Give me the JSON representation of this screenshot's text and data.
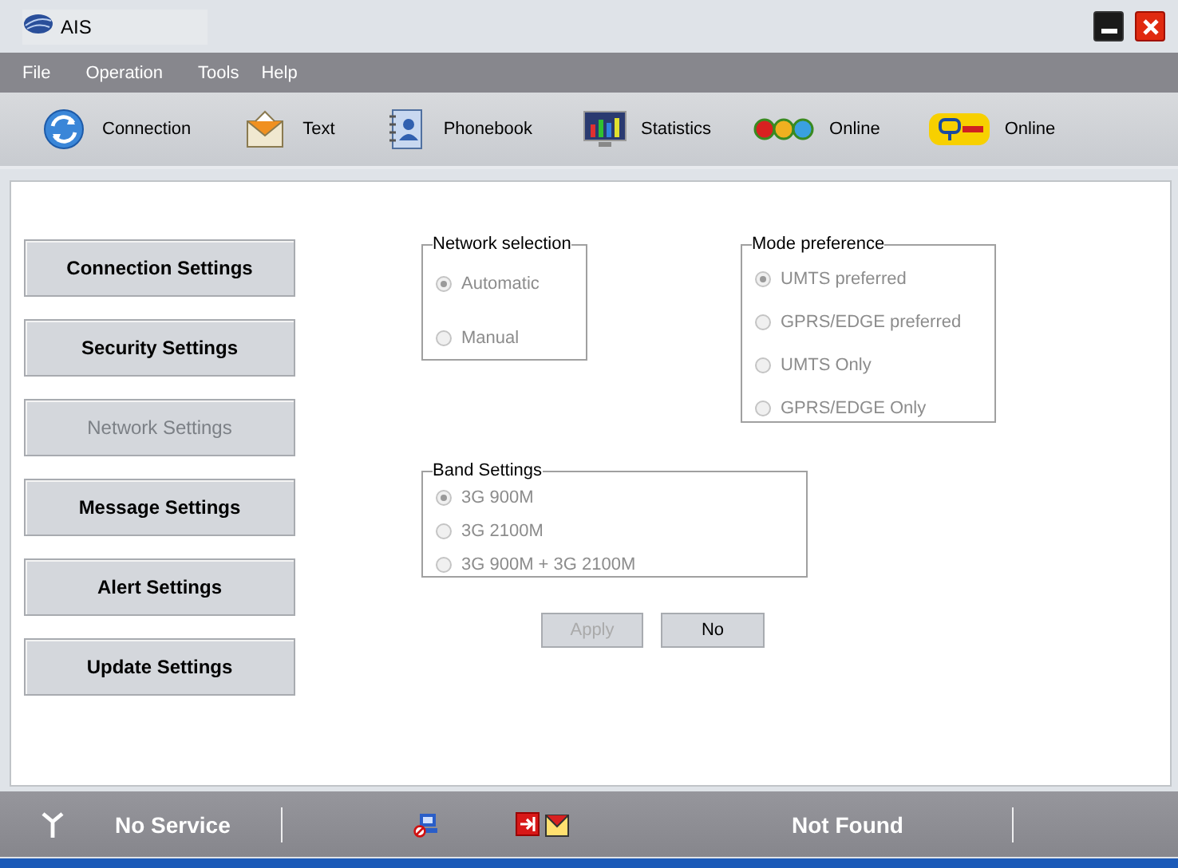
{
  "window": {
    "title": "AIS"
  },
  "menu": [
    "File",
    "Operation",
    "Tools",
    "Help"
  ],
  "toolbar": [
    {
      "kind": "connection",
      "label": "Connection"
    },
    {
      "kind": "text",
      "label": "Text"
    },
    {
      "kind": "phonebook",
      "label": "Phonebook"
    },
    {
      "kind": "statistics",
      "label": "Statistics"
    },
    {
      "kind": "call",
      "label": "Online"
    },
    {
      "kind": "gsm",
      "label": "Online"
    }
  ],
  "settings_buttons": [
    {
      "label": "Connection Settings",
      "disabled": false
    },
    {
      "label": "Security Settings",
      "disabled": false
    },
    {
      "label": "Network Settings",
      "disabled": true
    },
    {
      "label": "Message Settings",
      "disabled": false
    },
    {
      "label": "Alert Settings",
      "disabled": false
    },
    {
      "label": "Update Settings",
      "disabled": false
    }
  ],
  "network_selection": {
    "title": "Network selection",
    "options": [
      {
        "label": "Automatic",
        "selected": true,
        "disabled": true
      },
      {
        "label": "Manual",
        "selected": false,
        "disabled": true
      }
    ]
  },
  "mode_preference": {
    "title": "Mode preference",
    "options": [
      {
        "label": "UMTS preferred",
        "selected": true,
        "disabled": true
      },
      {
        "label": "GPRS/EDGE preferred",
        "selected": false,
        "disabled": true
      },
      {
        "label": "UMTS Only",
        "selected": false,
        "disabled": true
      },
      {
        "label": "GPRS/EDGE Only",
        "selected": false,
        "disabled": true
      }
    ]
  },
  "band_settings": {
    "title": "Band Settings",
    "options": [
      {
        "label": "3G 900M",
        "selected": true,
        "disabled": true
      },
      {
        "label": "3G 2100M",
        "selected": false,
        "disabled": true
      },
      {
        "label": "3G 900M + 3G 2100M",
        "selected": false,
        "disabled": true
      }
    ]
  },
  "actions": [
    {
      "label": "Apply",
      "disabled": true
    },
    {
      "label": "No",
      "disabled": false
    }
  ],
  "status_bar": {
    "signal": "No Service",
    "device": "Not Found"
  }
}
